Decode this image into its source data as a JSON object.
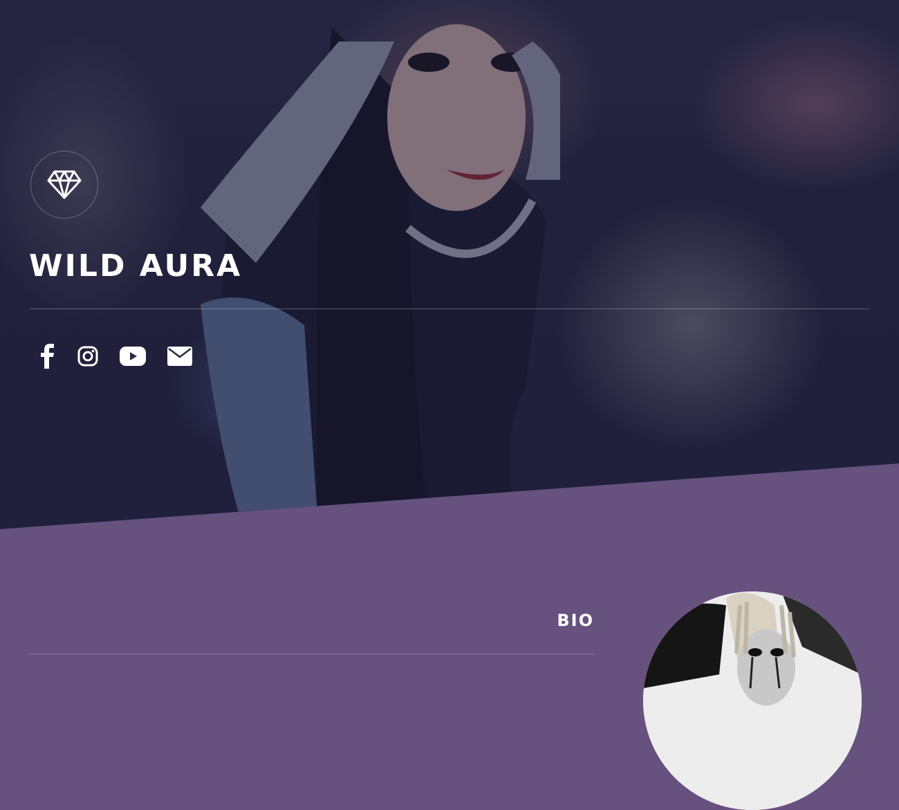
{
  "hero": {
    "site_title": "WILD AURA",
    "logo_icon": "diamond-icon"
  },
  "social_links": [
    {
      "name": "facebook",
      "icon": "facebook-icon"
    },
    {
      "name": "instagram",
      "icon": "instagram-icon"
    },
    {
      "name": "youtube",
      "icon": "youtube-icon"
    },
    {
      "name": "email",
      "icon": "envelope-icon"
    }
  ],
  "bio": {
    "heading": "BIO"
  },
  "colors": {
    "section_purple": "#66517f",
    "hero_overlay": "#232341",
    "text": "#ffffff"
  }
}
